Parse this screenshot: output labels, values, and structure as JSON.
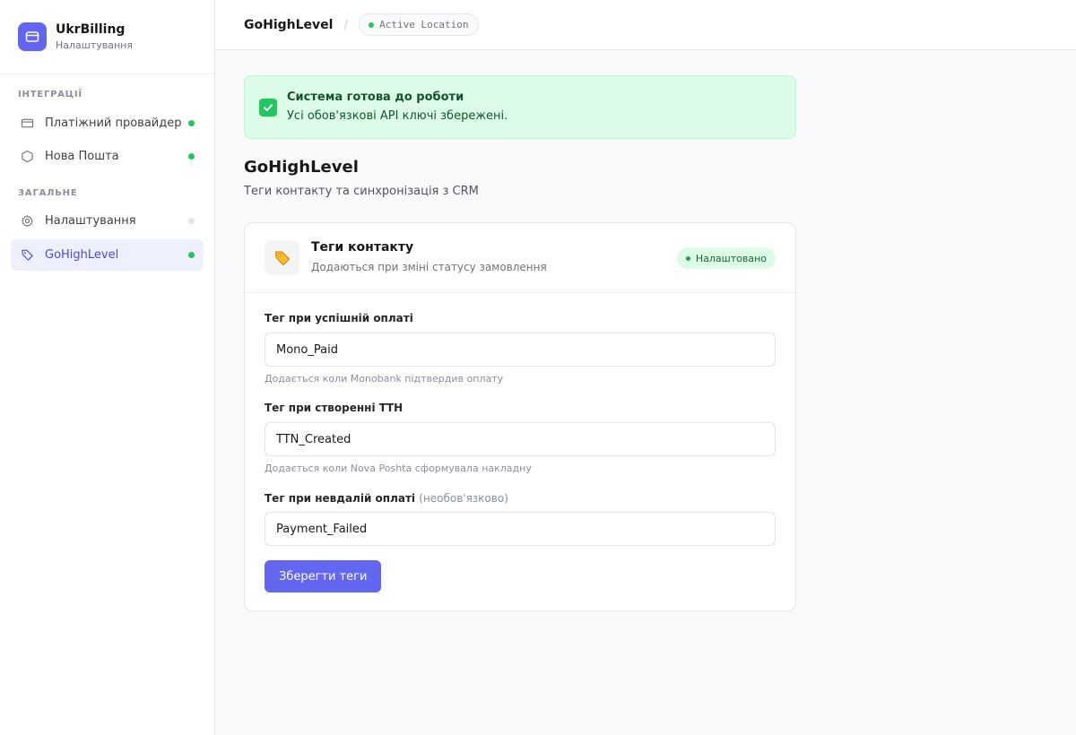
{
  "brand": {
    "title": "UkrBilling",
    "subtitle": "Налаштування"
  },
  "sidebar": {
    "sections": [
      {
        "title": "ІНТЕГРАЦІЇ"
      },
      {
        "title": "ЗАГАЛЬНЕ"
      }
    ],
    "items": [
      {
        "label": "Платіжний провайдер",
        "icon": "credit-card-icon",
        "status": "active"
      },
      {
        "label": "Нова Пошта",
        "icon": "box-icon",
        "status": "active"
      },
      {
        "label": "Налаштування",
        "icon": "gear-icon",
        "status": "inactive"
      },
      {
        "label": "GoHighLevel",
        "icon": "tag-icon",
        "status": "active",
        "selected": true
      }
    ]
  },
  "topbar": {
    "title": "GoHighLevel",
    "separator": "/",
    "badge": "Active Location"
  },
  "alert": {
    "title": "Система готова до роботи",
    "description": "Усі обов'язкові API ключі збережені.",
    "icon": "check-icon"
  },
  "page": {
    "title": "GoHighLevel",
    "subtitle": "Теги контакту та синхронізація з CRM"
  },
  "card": {
    "title": "Теги контакту",
    "subtitle": "Додаються при зміні статусу замовлення",
    "icon": "tag-emoji-icon",
    "status": "Налаштовано",
    "fields": [
      {
        "label": "Тег при успішній оплаті",
        "value": "Mono_Paid",
        "hint": "Додається коли Monobank підтвердив оплату"
      },
      {
        "label": "Тег при створенні ТТН",
        "value": "TTN_Created",
        "hint": "Додається коли Nova Poshta сформувала накладну"
      },
      {
        "label": "Тег при невдалій оплаті",
        "optional": "(необов'язково)",
        "value": "Payment_Failed"
      }
    ],
    "save_label": "Зберегти теги"
  },
  "colors": {
    "accent": "#6366f1",
    "success": "#22c55e",
    "success_bg": "#dcfce7"
  }
}
